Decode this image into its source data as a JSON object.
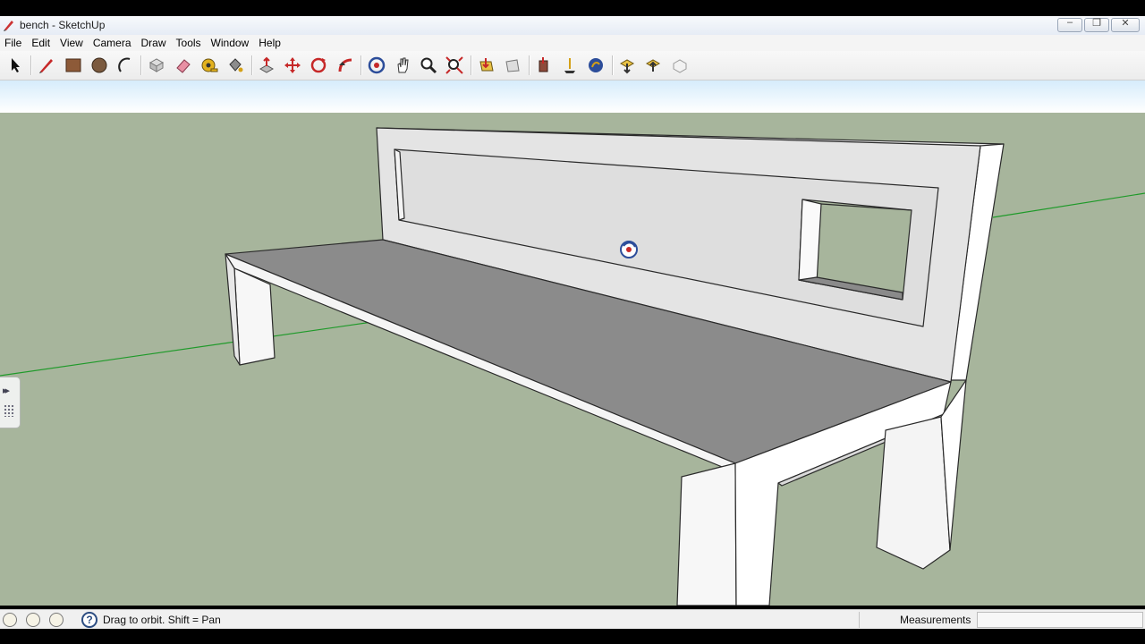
{
  "window": {
    "title": "bench - SketchUp"
  },
  "menu": [
    "File",
    "Edit",
    "View",
    "Camera",
    "Draw",
    "Tools",
    "Window",
    "Help"
  ],
  "toolbar": {
    "tools": [
      {
        "name": "select-tool-icon"
      },
      {
        "name": "line-tool-icon"
      },
      {
        "name": "rectangle-tool-icon"
      },
      {
        "name": "circle-tool-icon"
      },
      {
        "name": "arc-tool-icon"
      },
      {
        "name": "make-component-icon"
      },
      {
        "name": "eraser-tool-icon"
      },
      {
        "name": "tape-measure-icon"
      },
      {
        "name": "paint-bucket-icon"
      },
      {
        "name": "push-pull-icon"
      },
      {
        "name": "move-tool-icon"
      },
      {
        "name": "rotate-tool-icon"
      },
      {
        "name": "follow-me-icon"
      },
      {
        "name": "orbit-tool-icon"
      },
      {
        "name": "pan-tool-icon"
      },
      {
        "name": "zoom-tool-icon"
      },
      {
        "name": "zoom-extents-icon"
      },
      {
        "name": "get-models-icon"
      },
      {
        "name": "share-model-icon"
      },
      {
        "name": "share-component-icon"
      },
      {
        "name": "position-camera-icon"
      },
      {
        "name": "walk-tool-icon"
      },
      {
        "name": "look-around-icon"
      },
      {
        "name": "preview-google-earth-icon"
      },
      {
        "name": "get-current-view-icon"
      },
      {
        "name": "toggle-terrain-icon"
      }
    ]
  },
  "colors": {
    "sky": "#ffffff",
    "ground": "#a7b59c",
    "bench_face": "#e6e6e6",
    "bench_seat": "#8a8a8a",
    "green_axis": "#1f9a2a"
  },
  "status": {
    "hint": "Drag to orbit.  Shift = Pan",
    "measurements_label": "Measurements",
    "measurements_value": ""
  }
}
